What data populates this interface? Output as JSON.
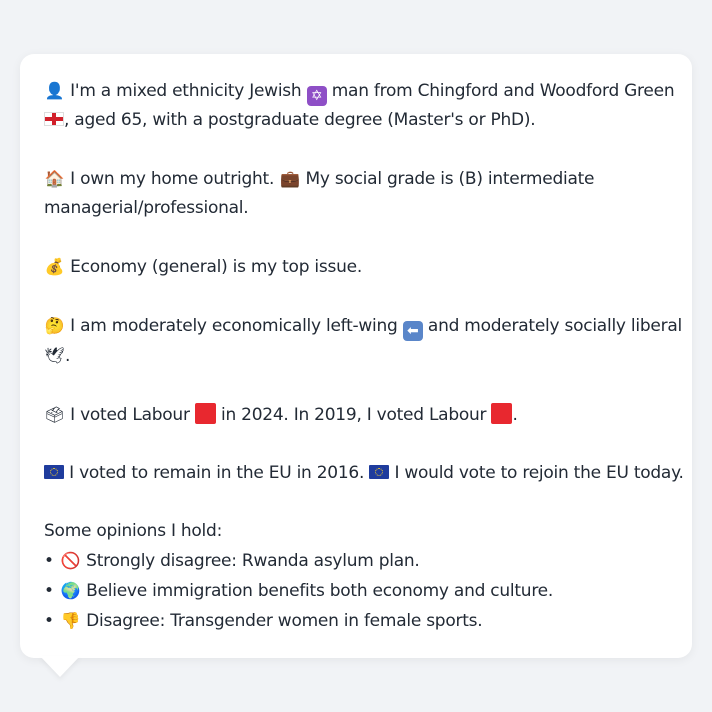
{
  "icons": {
    "person": "👤",
    "star_of_david": "✡",
    "england_flag": "england-flag",
    "house": "🏠",
    "briefcase": "💼",
    "money_bag": "💰",
    "thinking": "🤔",
    "left_arrow": "⬅",
    "dove": "🕊",
    "ballot_box": "🗳",
    "red_square_color": "#e8282f",
    "eu_flag_color": "#1f3c9d",
    "prohibited": "🚫",
    "globe": "🌍",
    "thumbs_down": "👎"
  },
  "profile": {
    "line1_a": "I'm a mixed ethnicity Jewish",
    "line1_b": "man from Chingford and Woodford Green",
    "line2": ", aged 65, with a postgraduate degree (Master's or PhD).",
    "home_a": "I own my home outright.",
    "home_b": "My social grade is (B) intermediate",
    "home_c": "managerial/professional.",
    "issue": "Economy (general) is my top issue.",
    "ideology_a": "I am moderately economically left-wing",
    "ideology_b": "and moderately socially liberal",
    "ideology_c": ".",
    "vote_a": "I voted Labour",
    "vote_b": "in 2024. In 2019, I voted Labour",
    "vote_c": ".",
    "eu_a": "I voted to remain in the EU in 2016.",
    "eu_b": "I would vote to rejoin the EU today."
  },
  "opinions": {
    "heading": "Some opinions I hold:",
    "bullet": "•",
    "items": [
      "Strongly disagree: Rwanda asylum plan.",
      "Believe immigration benefits both economy and culture.",
      "Disagree: Transgender women in female sports."
    ]
  }
}
